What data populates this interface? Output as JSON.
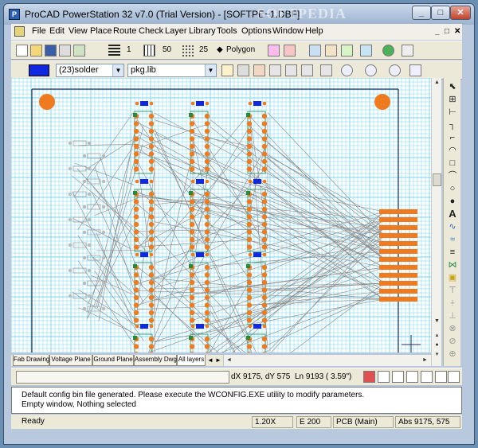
{
  "window": {
    "title": "ProCAD PowerStation 32 v7.0 (Trial Version) - [SOFTPE~1.DBF]",
    "watermark": "SOFTPEDIA"
  },
  "menu": [
    "File",
    "Edit",
    "View",
    "Place",
    "Route",
    "Check",
    "Layer",
    "Library",
    "Tools",
    "Options",
    "Window",
    "Help"
  ],
  "toolbar1": {
    "line_width": "1",
    "grid_size": "50",
    "snap_size": "25",
    "polygon_label": "Polygon"
  },
  "toolbar2": {
    "layer_combo": "(23)solder",
    "library_combo": "pkg.lib"
  },
  "tabs": [
    "Fab Drawing",
    "Voltage Plane",
    "Ground Plane",
    "Assembly Dwg",
    "All layers"
  ],
  "active_tab": "All layers",
  "coords": {
    "delta": "dX 9175, dY  575",
    "length": "Ln 9193  ( 3.59\")"
  },
  "messages": [
    "Default config bin file generated. Please execute the WCONFIG.EXE utility to modify parameters.",
    "Empty window, Nothing selected"
  ],
  "status": {
    "ready": "Ready",
    "zoom": "1.20X",
    "e_value": "E   200",
    "layer": "PCB (Main)",
    "abs": "Abs  9175,  575"
  },
  "colors": {
    "grid": "#7ad6f0",
    "pad": "#f07a1e",
    "trace": "#8a8a8a",
    "ic_body": "#2fa07a",
    "selected": "#1028e0"
  },
  "icons": {
    "right_toolbar": [
      "pointer-icon",
      "place-part-icon",
      "pin-icon",
      "wire-icon",
      "bus-icon",
      "arc-icon",
      "rect-icon",
      "line-icon",
      "circle-icon",
      "fill-circle-icon",
      "text-icon",
      "curve-icon",
      "wave-icon",
      "connector-icon",
      "chip-icon",
      "layer-icon",
      "probe-icon",
      "gnd-icon",
      "power-icon",
      "via-icon",
      "no-connect-icon",
      "zoom-icon"
    ]
  }
}
